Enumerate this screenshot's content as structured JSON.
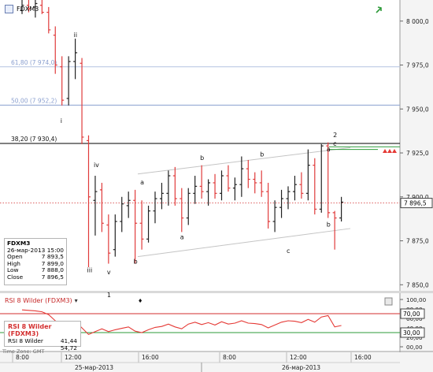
{
  "symbol": "FDXM3",
  "chart_data": [
    {
      "type": "candlestick",
      "title": "FDXM3",
      "ylim": [
        7847,
        8012
      ],
      "price_axis_labels": [
        "8 000,0",
        "7 975,0",
        "7 950,0",
        "7 925,0",
        "7 900,0",
        "7 875,0",
        "7 850,0"
      ],
      "price_axis_values": [
        8000,
        7975,
        7950,
        7925,
        7900,
        7875,
        7850
      ],
      "current_price": "7 896,5",
      "fib_levels": [
        {
          "label": "61,80  (7 974,0)",
          "value": 7974.0,
          "color": "#b3c3e0"
        },
        {
          "label": "50,00  (7 952,2)",
          "value": 7952.2,
          "color": "#8a9fcf"
        },
        {
          "label": "38,20  (7 930,4)",
          "value": 7930.4,
          "color": "#000000"
        }
      ],
      "wave_labels": [
        {
          "text": "ii",
          "i": 8,
          "price": 7991
        },
        {
          "text": "i",
          "i": 6,
          "price": 7942
        },
        {
          "text": "iv",
          "i": 11,
          "price": 7917
        },
        {
          "text": "iii",
          "i": 10,
          "price": 7857
        },
        {
          "text": "a",
          "i": 18,
          "price": 7907
        },
        {
          "text": "v",
          "i": 13,
          "price": 7856
        },
        {
          "text": "1",
          "i": 13,
          "price": 7843
        },
        {
          "text": "b",
          "i": 17,
          "price": 7862
        },
        {
          "text": "b",
          "i": 27,
          "price": 7921
        },
        {
          "text": "a",
          "i": 24,
          "price": 7876
        },
        {
          "text": "b",
          "i": 36,
          "price": 7923
        },
        {
          "text": "c",
          "i": 40,
          "price": 7868
        },
        {
          "text": "a",
          "i": 46,
          "price": 7926
        },
        {
          "text": "c",
          "i": 47,
          "price": 7929
        },
        {
          "text": "2",
          "i": 47,
          "price": 7934
        },
        {
          "text": "b",
          "i": 46,
          "price": 7883
        }
      ],
      "candles": [
        {
          "o": 8006,
          "h": 8012,
          "l": 8004,
          "c": 8009
        },
        {
          "o": 8009,
          "h": 8012,
          "l": 8005,
          "c": 8007
        },
        {
          "o": 8008,
          "h": 8012,
          "l": 8002,
          "c": 8010
        },
        {
          "o": 8009,
          "h": 8012,
          "l": 8004,
          "c": 8005
        },
        {
          "o": 8005,
          "h": 8008,
          "l": 7993,
          "c": 7995
        },
        {
          "o": 7992,
          "h": 7997,
          "l": 7970,
          "c": 7975
        },
        {
          "o": 7974,
          "h": 7980,
          "l": 7952,
          "c": 7955
        },
        {
          "o": 7956,
          "h": 7980,
          "l": 7952,
          "c": 7977
        },
        {
          "o": 7977,
          "h": 7990,
          "l": 7967,
          "c": 7982
        },
        {
          "o": 7976,
          "h": 7979,
          "l": 7930,
          "c": 7934
        },
        {
          "o": 7932,
          "h": 7935,
          "l": 7860,
          "c": 7900
        },
        {
          "o": 7898,
          "h": 7912,
          "l": 7878,
          "c": 7903
        },
        {
          "o": 7904,
          "h": 7908,
          "l": 7880,
          "c": 7885
        },
        {
          "o": 7884,
          "h": 7890,
          "l": 7862,
          "c": 7868
        },
        {
          "o": 7870,
          "h": 7890,
          "l": 7866,
          "c": 7886
        },
        {
          "o": 7886,
          "h": 7900,
          "l": 7880,
          "c": 7896
        },
        {
          "o": 7895,
          "h": 7903,
          "l": 7888,
          "c": 7898
        },
        {
          "o": 7898,
          "h": 7904,
          "l": 7862,
          "c": 7885
        },
        {
          "o": 7885,
          "h": 7898,
          "l": 7870,
          "c": 7876
        },
        {
          "o": 7876,
          "h": 7895,
          "l": 7874,
          "c": 7892
        },
        {
          "o": 7892,
          "h": 7903,
          "l": 7885,
          "c": 7899
        },
        {
          "o": 7899,
          "h": 7908,
          "l": 7893,
          "c": 7902
        },
        {
          "o": 7902,
          "h": 7915,
          "l": 7895,
          "c": 7912
        },
        {
          "o": 7912,
          "h": 7917,
          "l": 7895,
          "c": 7899
        },
        {
          "o": 7899,
          "h": 7905,
          "l": 7880,
          "c": 7888
        },
        {
          "o": 7888,
          "h": 7905,
          "l": 7884,
          "c": 7902
        },
        {
          "o": 7902,
          "h": 7912,
          "l": 7896,
          "c": 7906
        },
        {
          "o": 7906,
          "h": 7918,
          "l": 7899,
          "c": 7903
        },
        {
          "o": 7903,
          "h": 7910,
          "l": 7895,
          "c": 7908
        },
        {
          "o": 7908,
          "h": 7913,
          "l": 7899,
          "c": 7902
        },
        {
          "o": 7902,
          "h": 7915,
          "l": 7898,
          "c": 7912
        },
        {
          "o": 7912,
          "h": 7918,
          "l": 7903,
          "c": 7905
        },
        {
          "o": 7905,
          "h": 7911,
          "l": 7898,
          "c": 7907
        },
        {
          "o": 7907,
          "h": 7923,
          "l": 7900,
          "c": 7916
        },
        {
          "o": 7916,
          "h": 7921,
          "l": 7905,
          "c": 7910
        },
        {
          "o": 7910,
          "h": 7914,
          "l": 7902,
          "c": 7908
        },
        {
          "o": 7908,
          "h": 7915,
          "l": 7900,
          "c": 7903
        },
        {
          "o": 7903,
          "h": 7908,
          "l": 7882,
          "c": 7886
        },
        {
          "o": 7886,
          "h": 7898,
          "l": 7880,
          "c": 7894
        },
        {
          "o": 7894,
          "h": 7904,
          "l": 7888,
          "c": 7899
        },
        {
          "o": 7899,
          "h": 7906,
          "l": 7893,
          "c": 7903
        },
        {
          "o": 7903,
          "h": 7912,
          "l": 7898,
          "c": 7907
        },
        {
          "o": 7907,
          "h": 7914,
          "l": 7899,
          "c": 7902
        },
        {
          "o": 7902,
          "h": 7927,
          "l": 7898,
          "c": 7918
        },
        {
          "o": 7918,
          "h": 7922,
          "l": 7890,
          "c": 7893
        },
        {
          "o": 7893,
          "h": 7930,
          "l": 7891,
          "c": 7929
        },
        {
          "o": 7929,
          "h": 7931,
          "l": 7888,
          "c": 7891
        },
        {
          "o": 7891,
          "h": 7892,
          "l": 7870,
          "c": 7888
        },
        {
          "o": 7888,
          "h": 7900,
          "l": 7886,
          "c": 7897
        }
      ],
      "ohlc_panel": {
        "symbol": "FDXM3",
        "datetime": "26-мар-2013 15:00",
        "rows": [
          {
            "label": "Open",
            "value": "7 893,5"
          },
          {
            "label": "High",
            "value": "7 899,0"
          },
          {
            "label": "Low",
            "value": "7 888,0"
          },
          {
            "label": "Close",
            "value": "7 896,5"
          }
        ]
      }
    },
    {
      "type": "line",
      "title": "RSI 8 Wilder (FDXM3)",
      "ylim": [
        0,
        100
      ],
      "axis_labels": [
        "100,00",
        "80,00",
        "60,00",
        "40,00",
        "20,00",
        "00,00"
      ],
      "axis_values": [
        100,
        80,
        60,
        40,
        20,
        0
      ],
      "levels": [
        {
          "label": "70,00",
          "value": 70,
          "color": "#d32f2f"
        },
        {
          "label": "30,00",
          "value": 30,
          "color": "#2e9b3a"
        }
      ],
      "series": [
        {
          "name": "RSI 8 Wilder",
          "color": "#e53935",
          "values": [
            78,
            77,
            76,
            74,
            68,
            55,
            43,
            52,
            54,
            40,
            26,
            32,
            38,
            32,
            36,
            39,
            42,
            33,
            30,
            36,
            41,
            43,
            48,
            42,
            38,
            48,
            52,
            47,
            51,
            46,
            53,
            48,
            50,
            55,
            50,
            49,
            47,
            40,
            46,
            52,
            55,
            54,
            51,
            58,
            52,
            63,
            66,
            42,
            45
          ]
        }
      ],
      "legend_panel": {
        "title": "RSI 8 Wilder (FDXM3)",
        "label": "RSI 8 Wilder",
        "values": [
          "41,44",
          "54,72"
        ]
      }
    }
  ],
  "x_axis": {
    "ticks": [
      "8:00",
      "12:00",
      "16:00",
      "8:00",
      "12:00",
      "16:00"
    ],
    "dates": [
      "25-мар-2013",
      "26-мар-2013"
    ]
  },
  "time_zone": "Time Zone: GMT"
}
